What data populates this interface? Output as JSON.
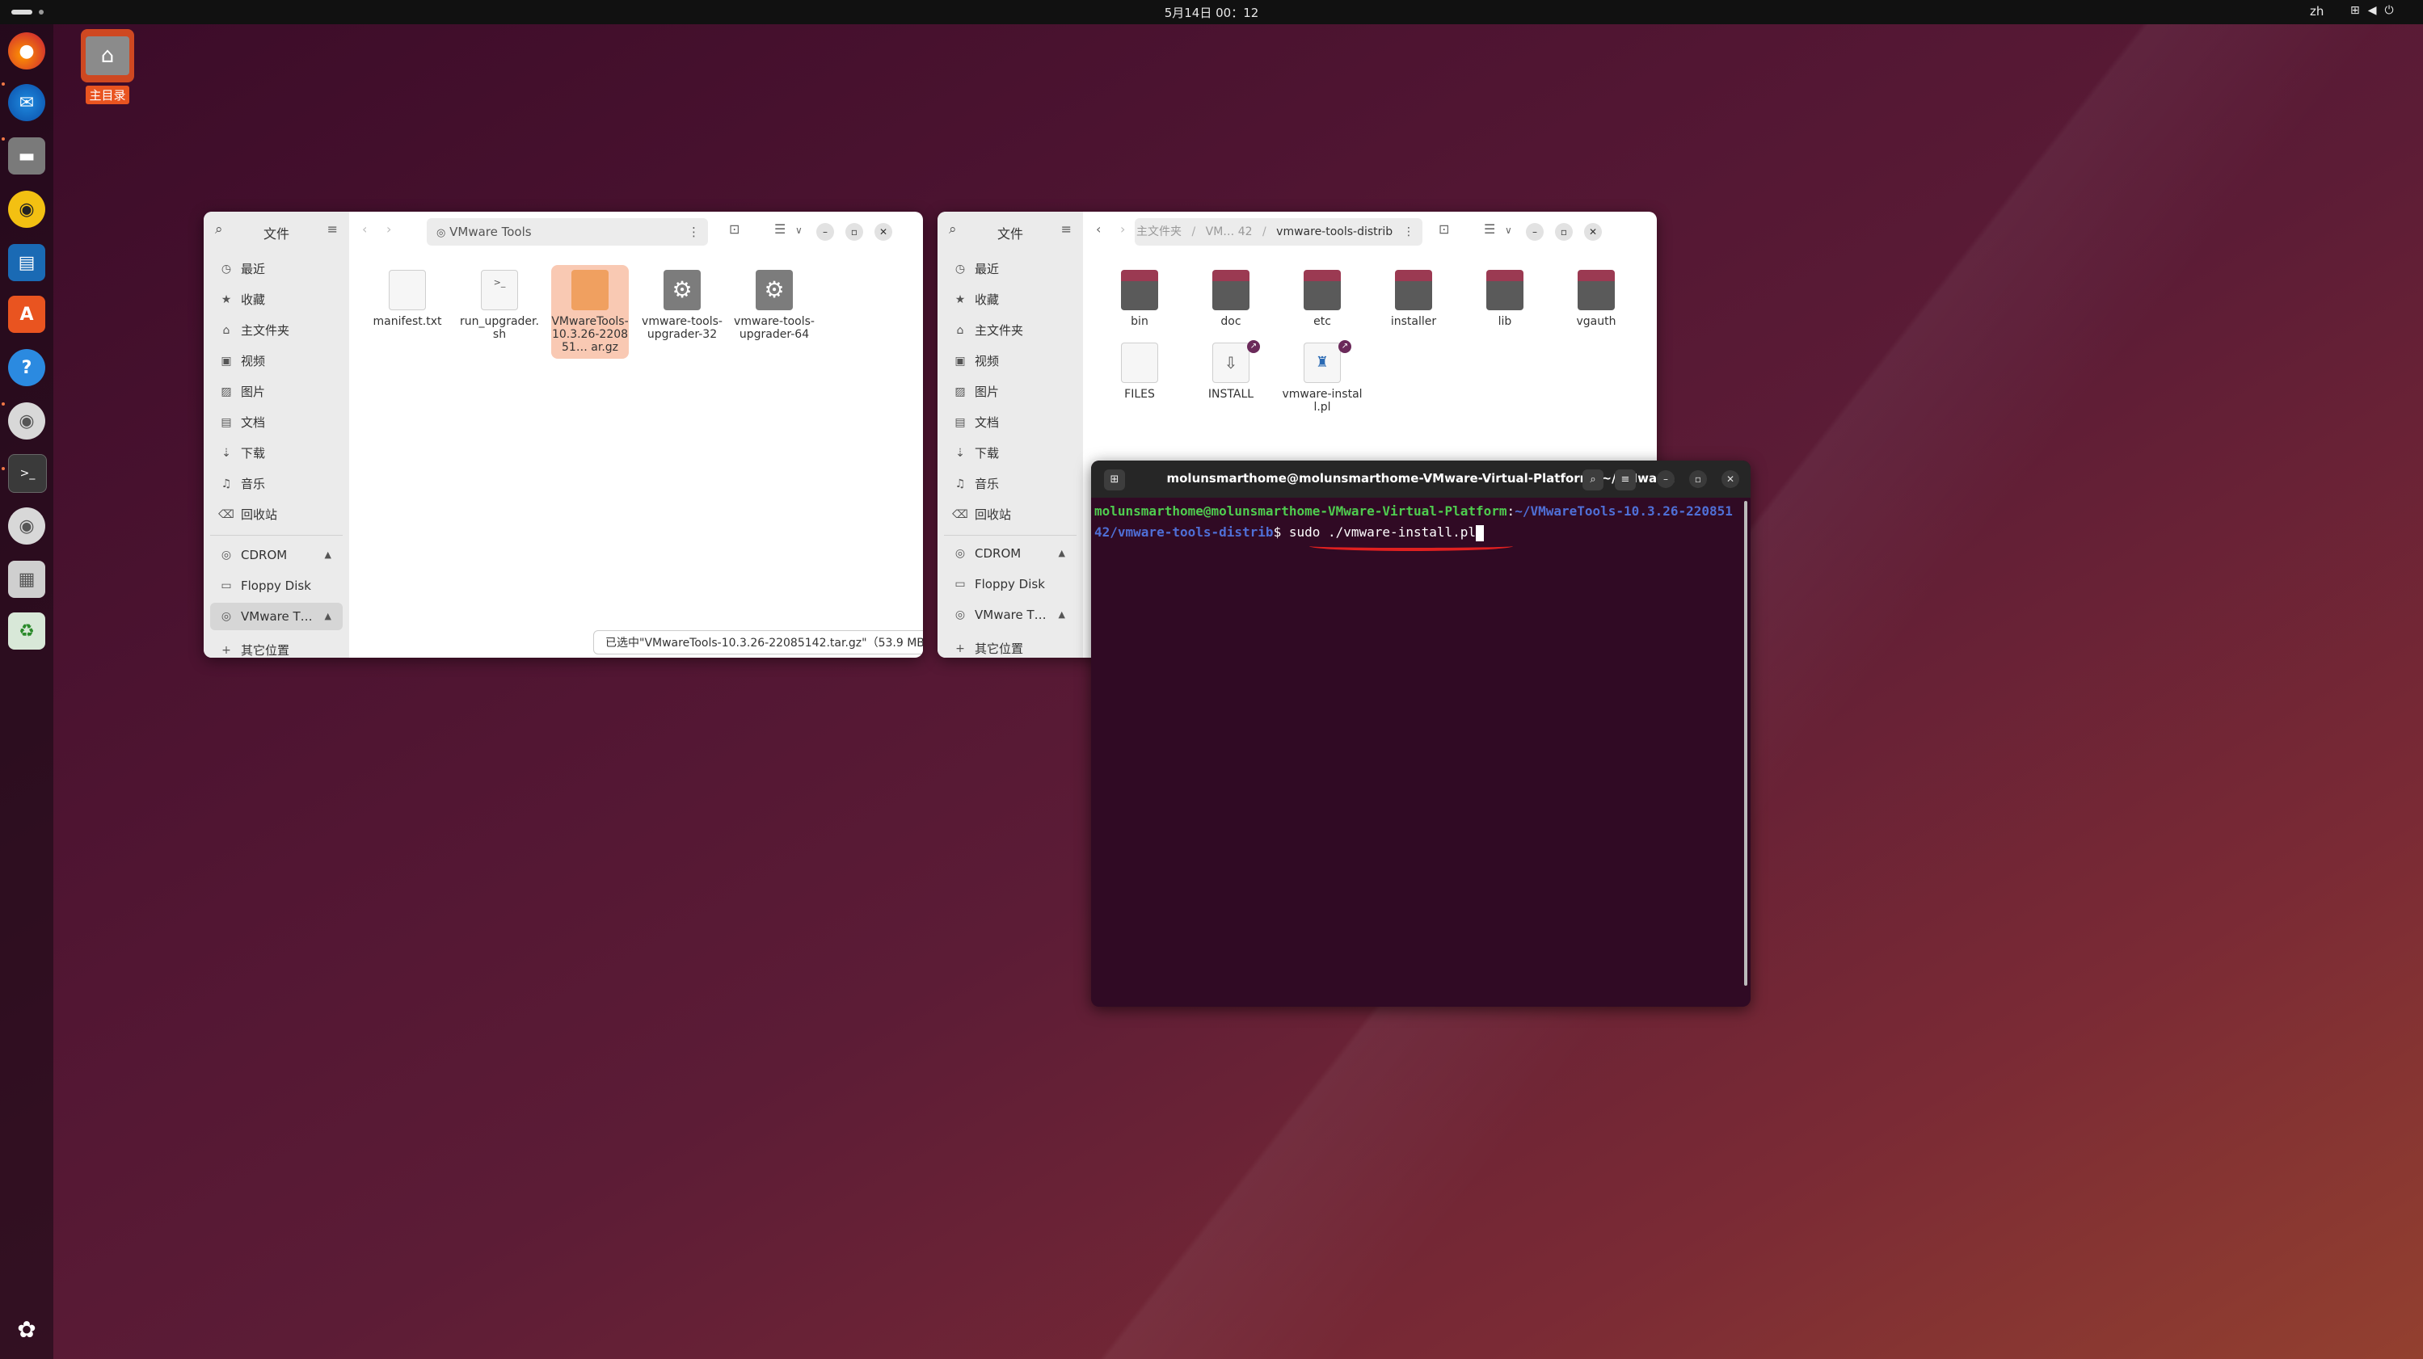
{
  "topbar": {
    "clock": "5月14日 00：12",
    "lang": "zh"
  },
  "desktop": {
    "home_label": "主目录"
  },
  "dock": {
    "items": [
      "firefox-icon",
      "thunderbird-icon",
      "files-icon",
      "rhythmbox-icon",
      "writer-icon",
      "app-center-icon",
      "help-icon",
      "disc-icon",
      "terminal-icon",
      "disc-icon",
      "floppy-icon",
      "trash-icon"
    ]
  },
  "sidebar_items": {
    "recent": "最近",
    "starred": "收藏",
    "home": "主文件夹",
    "videos": "视频",
    "pictures": "图片",
    "documents": "文档",
    "downloads": "下载",
    "music": "音乐",
    "trash": "回收站",
    "cdrom": "CDROM",
    "floppy": "Floppy Disk",
    "vmware": "VMware T…",
    "other": "其它位置"
  },
  "win1": {
    "title": "文件",
    "path": "VMware Tools",
    "files": [
      {
        "name": "manifest.txt",
        "type": "text"
      },
      {
        "name": "run_upgrader.sh",
        "type": "script"
      },
      {
        "name": "VMwareTools-10.3.26-220851… ar.gz",
        "type": "archive",
        "selected": true
      },
      {
        "name": "vmware-tools-upgrader-32",
        "type": "executable"
      },
      {
        "name": "vmware-tools-upgrader-64",
        "type": "executable"
      }
    ],
    "status": "已选中\"VMwareTools-10.3.26-22085142.tar.gz\"（53.9 MB）"
  },
  "win2": {
    "title": "文件",
    "crumbs": [
      "主文件夹",
      "/",
      "VM… 42",
      "/",
      "vmware-tools-distrib"
    ],
    "folders": [
      "bin",
      "doc",
      "etc",
      "installer",
      "lib",
      "vgauth"
    ],
    "files": [
      "FILES",
      "INSTALL",
      "vmware-install.pl"
    ]
  },
  "terminal": {
    "title": "molunsmarthome@molunsmarthome-VMware-Virtual-Platform: ~/VMwar…",
    "user_host": "molunsmarthome@molunsmarthome-VMware-Virtual-Platform",
    "path": "~/VMwareTools-10.3.26-22085142/vmware-tools-distrib",
    "command": "sudo ./vmware-install.pl"
  },
  "colors": {
    "accent": "#e95420",
    "terminal_bg": "#300a24",
    "annotation": "#e02020"
  }
}
